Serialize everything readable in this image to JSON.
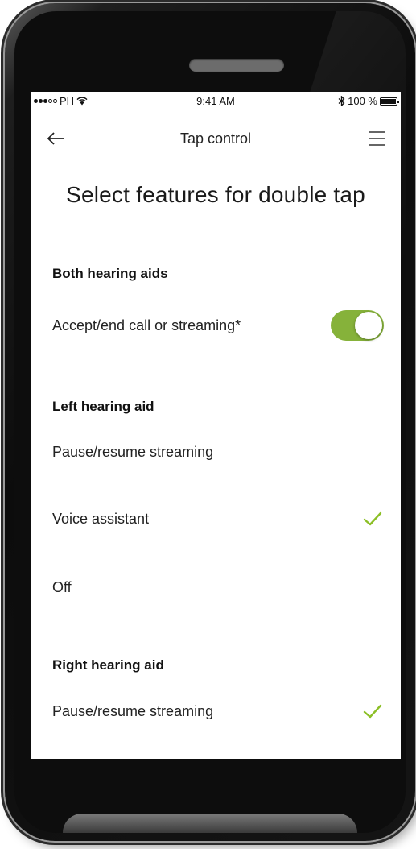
{
  "status_bar": {
    "carrier": "PH",
    "time": "9:41 AM",
    "battery": "100 %"
  },
  "nav": {
    "title": "Tap control",
    "back_icon": "back-arrow-icon",
    "menu_icon": "hamburger-menu-icon"
  },
  "page_title": "Select features for double tap",
  "sections": {
    "both": {
      "header": "Both hearing aids",
      "toggle_row": {
        "label": "Accept/end call or streaming*",
        "enabled": true
      }
    },
    "left": {
      "header": "Left hearing aid",
      "options": [
        {
          "label": "Pause/resume streaming",
          "selected": false
        },
        {
          "label": "Voice assistant",
          "selected": true
        },
        {
          "label": "Off",
          "selected": false
        }
      ]
    },
    "right": {
      "header": "Right hearing aid",
      "options": [
        {
          "label": "Pause/resume streaming",
          "selected": true
        }
      ]
    }
  },
  "colors": {
    "accent": "#86b23a",
    "check": "#8cbf26"
  }
}
